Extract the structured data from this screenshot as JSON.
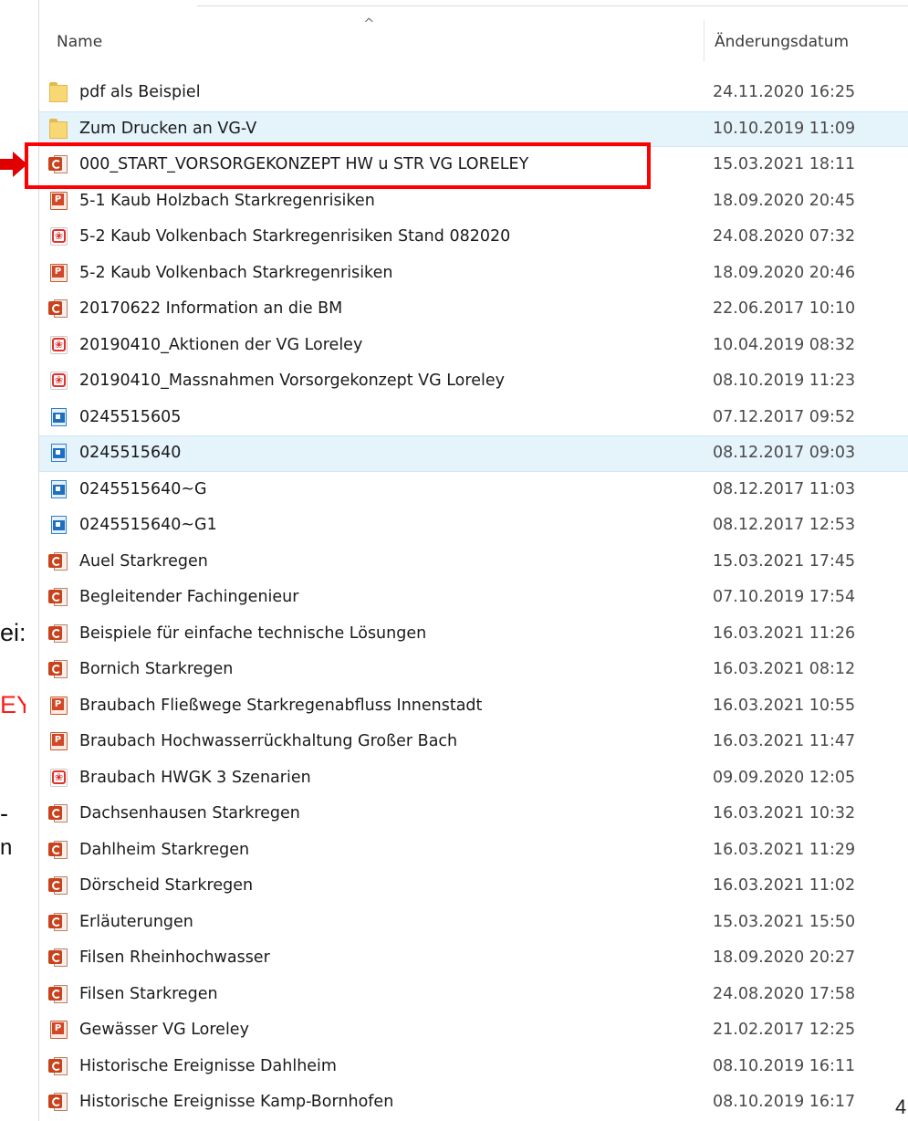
{
  "slide": {
    "fragments": [
      "ei:",
      "EY",
      "-",
      "n"
    ],
    "page_number": "4"
  },
  "header": {
    "name_label": "Name",
    "date_label": "Änderungsdatum",
    "sort_indicator": "^"
  },
  "icons": {
    "folder": "folder-icon",
    "ppt_show": "powerpoint-show-icon",
    "ppt": "powerpoint-icon",
    "pdf": "pdf-icon",
    "blue": "blue-document-icon"
  },
  "colors": {
    "annotation_red": "#ff0000",
    "selection_blue": "#e5f3fb"
  },
  "files": [
    {
      "name": "pdf als Beispiel",
      "date": "24.11.2020 16:25",
      "type": "folder"
    },
    {
      "name": "Zum Drucken an VG-V",
      "date": "10.10.2019 11:09",
      "type": "folder",
      "selected": true
    },
    {
      "name": "000_START_VORSORGEKONZEPT HW u STR VG LORELEY",
      "date": "15.03.2021 18:11",
      "type": "ppt_show",
      "highlighted": true
    },
    {
      "name": "5-1 Kaub Holzbach Starkregenrisiken",
      "date": "18.09.2020 20:45",
      "type": "ppt"
    },
    {
      "name": "5-2 Kaub Volkenbach Starkregenrisiken Stand 082020",
      "date": "24.08.2020 07:32",
      "type": "pdf"
    },
    {
      "name": "5-2 Kaub Volkenbach Starkregenrisiken",
      "date": "18.09.2020 20:46",
      "type": "ppt"
    },
    {
      "name": "20170622 Information an die BM",
      "date": "22.06.2017 10:10",
      "type": "ppt_show"
    },
    {
      "name": "20190410_Aktionen der VG Loreley",
      "date": "10.04.2019 08:32",
      "type": "pdf"
    },
    {
      "name": "20190410_Massnahmen Vorsorgekonzept VG Loreley",
      "date": "08.10.2019 11:23",
      "type": "pdf"
    },
    {
      "name": "0245515605",
      "date": "07.12.2017 09:52",
      "type": "blue"
    },
    {
      "name": "0245515640",
      "date": "08.12.2017 09:03",
      "type": "blue",
      "selected": true
    },
    {
      "name": "0245515640~G",
      "date": "08.12.2017 11:03",
      "type": "blue"
    },
    {
      "name": "0245515640~G1",
      "date": "08.12.2017 12:53",
      "type": "blue"
    },
    {
      "name": "Auel Starkregen",
      "date": "15.03.2021 17:45",
      "type": "ppt_show"
    },
    {
      "name": "Begleitender Fachingenieur",
      "date": "07.10.2019 17:54",
      "type": "ppt_show"
    },
    {
      "name": "Beispiele für einfache technische Lösungen",
      "date": "16.03.2021 11:26",
      "type": "ppt_show"
    },
    {
      "name": "Bornich Starkregen",
      "date": "16.03.2021 08:12",
      "type": "ppt_show"
    },
    {
      "name": "Braubach Fließwege Starkregenabfluss Innenstadt",
      "date": "16.03.2021 10:55",
      "type": "ppt"
    },
    {
      "name": "Braubach Hochwasserrückhaltung Großer Bach",
      "date": "16.03.2021 11:47",
      "type": "ppt"
    },
    {
      "name": "Braubach HWGK 3 Szenarien",
      "date": "09.09.2020 12:05",
      "type": "pdf"
    },
    {
      "name": "Dachsenhausen Starkregen",
      "date": "16.03.2021 10:32",
      "type": "ppt_show"
    },
    {
      "name": "Dahlheim Starkregen",
      "date": "16.03.2021 11:29",
      "type": "ppt_show"
    },
    {
      "name": "Dörscheid Starkregen",
      "date": "16.03.2021 11:02",
      "type": "ppt_show"
    },
    {
      "name": "Erläuterungen",
      "date": "15.03.2021 15:50",
      "type": "ppt_show"
    },
    {
      "name": "Filsen Rheinhochwasser",
      "date": "18.09.2020 20:27",
      "type": "ppt_show"
    },
    {
      "name": "Filsen Starkregen",
      "date": "24.08.2020 17:58",
      "type": "ppt_show"
    },
    {
      "name": "Gewässer VG Loreley",
      "date": "21.02.2017 12:25",
      "type": "ppt"
    },
    {
      "name": "Historische Ereignisse Dahlheim",
      "date": "08.10.2019 16:11",
      "type": "ppt_show"
    },
    {
      "name": "Historische Ereignisse Kamp-Bornhofen",
      "date": "08.10.2019 16:17",
      "type": "ppt_show"
    }
  ]
}
